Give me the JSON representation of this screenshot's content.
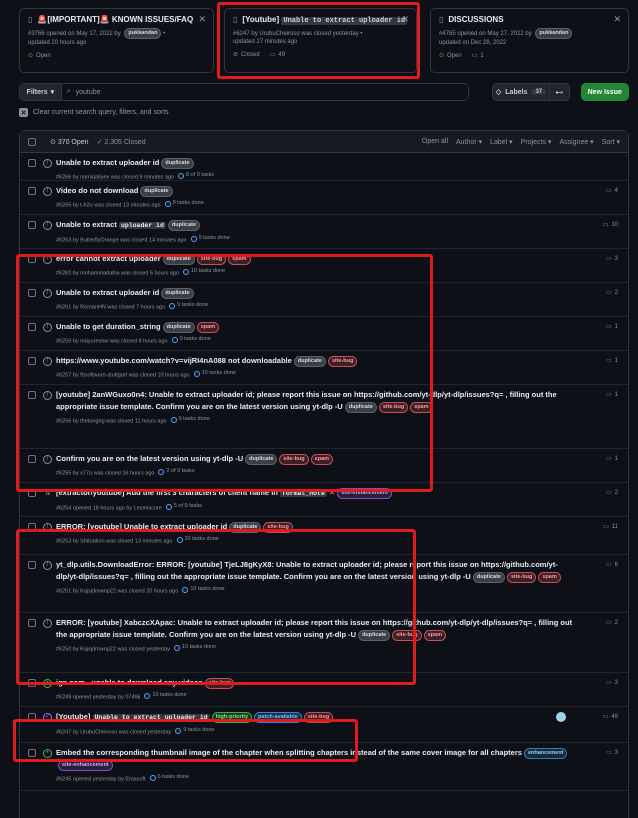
{
  "pinned": [
    {
      "title": "🚨[IMPORTANT]🚨 KNOWN ISSUES/FAQ",
      "meta1": "#3766 opened on May 17, 2022 by",
      "user": "pukkandan",
      "meta2": "updated 20 hours ago",
      "status": "Open",
      "comments": ""
    },
    {
      "title_prefix": "[Youtube]",
      "title_code": "Unable to extract uploader id",
      "meta1": "#6247 by UrubuCheiroso was closed yesterday •",
      "meta2": "updated 27 minutes ago",
      "status": "Closed",
      "comments": "49"
    },
    {
      "title": "DISCUSSIONS",
      "meta1": "#4765 opened on May 27, 2022 by",
      "user": "pukkandan",
      "meta2": "updated on Dec 28, 2022",
      "status": "Open",
      "comments": "1"
    }
  ],
  "toolbar": {
    "filters": "Filters",
    "search": "youtube",
    "labels": "Labels",
    "labels_count": "37",
    "new_issue": "New Issue"
  },
  "clear_text": "Clear current search query, filters, and sorts",
  "list_header": {
    "open": "370 Open",
    "closed": "2,305 Closed",
    "filters": [
      "Open all",
      "Author ▾",
      "Label ▾",
      "Projects ▾",
      "Assignee ▾",
      "Sort ▾"
    ]
  },
  "issues": [
    {
      "title": "Unable to extract uploader id",
      "labels": [
        "duplicate"
      ],
      "meta": "#6266 by namiqaliyev was closed 9 minutes ago",
      "tasks": "8 of 9 tasks",
      "comments": ""
    },
    {
      "title": "Video do not download",
      "labels": [
        "duplicate"
      ],
      "meta": "#6265 by t-h2o was closed 13 minutes ago",
      "tasks": "9 tasks done",
      "comments": "4"
    },
    {
      "title": "Unable to extract",
      "code": "uploader id",
      "labels": [
        "duplicate"
      ],
      "meta": "#6263 by ButterflyOrange was closed 14 minutes ago",
      "tasks": "9 tasks done",
      "comments": "10"
    },
    {
      "title": "error cannot extract uploader",
      "labels": [
        "duplicate",
        "site-bug",
        "spam"
      ],
      "meta": "#6262 by mohammadalha was closed 5 hours ago",
      "tasks": "10 tasks done",
      "comments": "3"
    },
    {
      "title": "Unable to extract uploader id",
      "labels": [
        "duplicate"
      ],
      "meta": "#6261 by RomanHN was closed 7 hours ago",
      "tasks": "9 tasks done",
      "comments": "2"
    },
    {
      "title": "Unable to get duration_string",
      "labels": [
        "duplicate",
        "spam"
      ],
      "meta": "#6259 by mayureshw was closed 9 hours ago",
      "tasks": "9 tasks done",
      "comments": "1"
    },
    {
      "title": "https://www.youtube.com/watch?v=vijRI4nA088 not downloadable",
      "labels": [
        "duplicate",
        "site-bug"
      ],
      "meta": "#6257 by fbsoftware-stuttgart was closed 10 hours ago",
      "tasks": "10 tasks done",
      "comments": "1"
    },
    {
      "title": "[youtube] 2anWGuxo0n4: Unable to extract uploader id; please report this issue on https://github.com/yt-dlp/yt-dlp/issues?q= , filling out the appropriate issue template. Confirm you are on the latest version using yt-dlp -U",
      "labels": [
        "duplicate",
        "site-bug",
        "spam"
      ],
      "meta": "#6256 by thetungng was closed 11 hours ago",
      "tasks": "9 tasks done",
      "comments": "1"
    },
    {
      "title": "Confirm you are on the latest version using yt-dlp -U",
      "labels": [
        "duplicate",
        "site-bug",
        "spam"
      ],
      "meta": "#6255 by x77a was closed 16 hours ago",
      "tasks": "2 of 9 tasks",
      "comments": "1"
    },
    {
      "title": "[extractor/youtube] Add the first 3 characters of client name in",
      "code": "format_note",
      "labels": [
        "site-enhancement"
      ],
      "meta": "#6254 opened 18 hours ago by Lesmiscore",
      "tasks": "5 of 9 tasks",
      "comments": "2",
      "pr": true
    },
    {
      "title": "ERROR: [youtube] Unable to extract uploader id",
      "labels": [
        "duplicate",
        "site-bug"
      ],
      "meta": "#6253 by Shituation was closed 13 minutes ago",
      "tasks": "10 tasks done",
      "comments": "11"
    },
    {
      "title": "yt_dlp.utils.DownloadError: ERROR: [youtube] TjeLJ8gKyX8: Unable to extract uploader id; please report this issue on https://github.com/yt-dlp/yt-dlp/issues?q= , filling out the appropriate issue template. Confirm you are on the latest version using yt-dlp -U",
      "labels": [
        "duplicate",
        "site-bug",
        "spam"
      ],
      "meta": "#6251 by Kajsjdmwnp22 was closed 20 hours ago",
      "tasks": "10 tasks done",
      "comments": "6"
    },
    {
      "title": "ERROR: [youtube] XabczcXApac: Unable to extract uploader id; please report this issue on https://github.com/yt-dlp/yt-dlp/issues?q= , filling out the appropriate issue template. Confirm you are on the latest version using yt-dlp -U",
      "labels": [
        "duplicate",
        "site-bug",
        "spam"
      ],
      "meta": "#6250 by Kajsjdmwnp22 was closed yesterday",
      "tasks": "10 tasks done",
      "comments": "2"
    },
    {
      "title": "ign.com - unable to download any videos",
      "labels": [
        "site-bug"
      ],
      "meta": "#6249 opened yesterday by 0749k",
      "tasks": "10 tasks done",
      "comments": "3",
      "open": true
    },
    {
      "title": "[Youtube]",
      "code": "Unable to extract uploader id",
      "labels": [
        "high-priority",
        "patch-available",
        "site-bug"
      ],
      "meta": "#6247 by UrubuCheiroso was closed yesterday",
      "tasks": "9 tasks done",
      "comments": "49",
      "completed": true
    },
    {
      "title": "Embed the corresponding thumbnail image of the chapter when splitting chapters instead of the same cover image for all chapters",
      "labels": [
        "enhancement",
        "site-enhancement"
      ],
      "meta": "#6245 opened yesterday by Emasoft",
      "tasks": "6 tasks done",
      "comments": "3",
      "open": true
    }
  ]
}
